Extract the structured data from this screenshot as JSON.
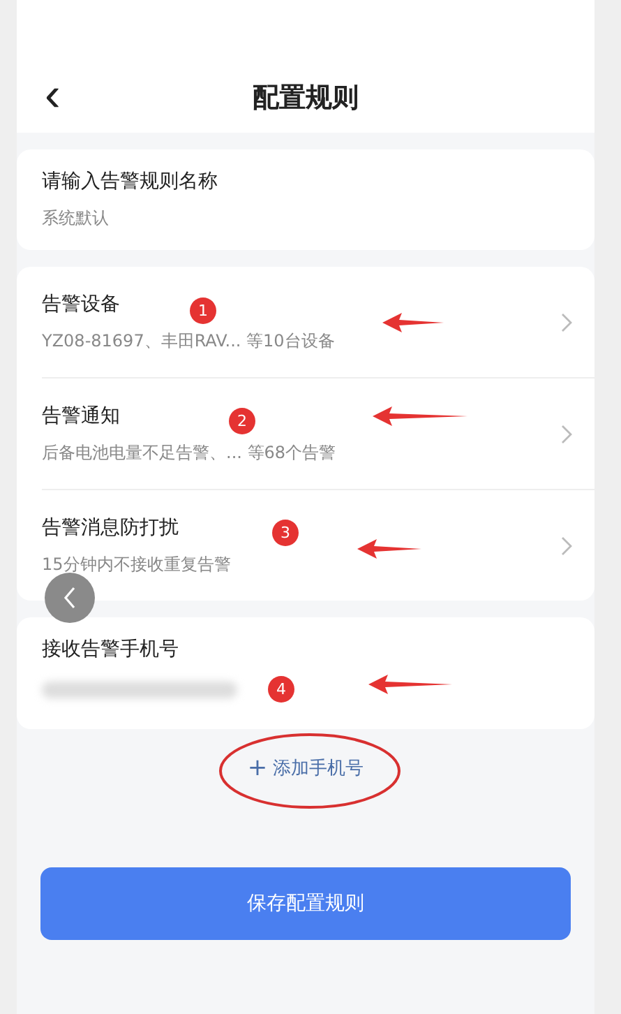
{
  "header": {
    "back": "‹",
    "title": "配置规则"
  },
  "name_card": {
    "label": "请输入告警规则名称",
    "value": "系统默认"
  },
  "settings": [
    {
      "title": "告警设备",
      "detail": "YZ08-81697、丰田RAV...  等10台设备"
    },
    {
      "title": "告警通知",
      "detail": "后备电池电量不足告警、... 等68个告警"
    },
    {
      "title": "告警消息防打扰",
      "detail": "15分钟内不接收重复告警"
    }
  ],
  "phone_card": {
    "label": "接收告警手机号"
  },
  "add_phone": {
    "icon": "+",
    "label": "添加手机号"
  },
  "save_button": "保存配置规则",
  "annotations": [
    {
      "number": "1"
    },
    {
      "number": "2"
    },
    {
      "number": "3"
    },
    {
      "number": "4"
    }
  ]
}
